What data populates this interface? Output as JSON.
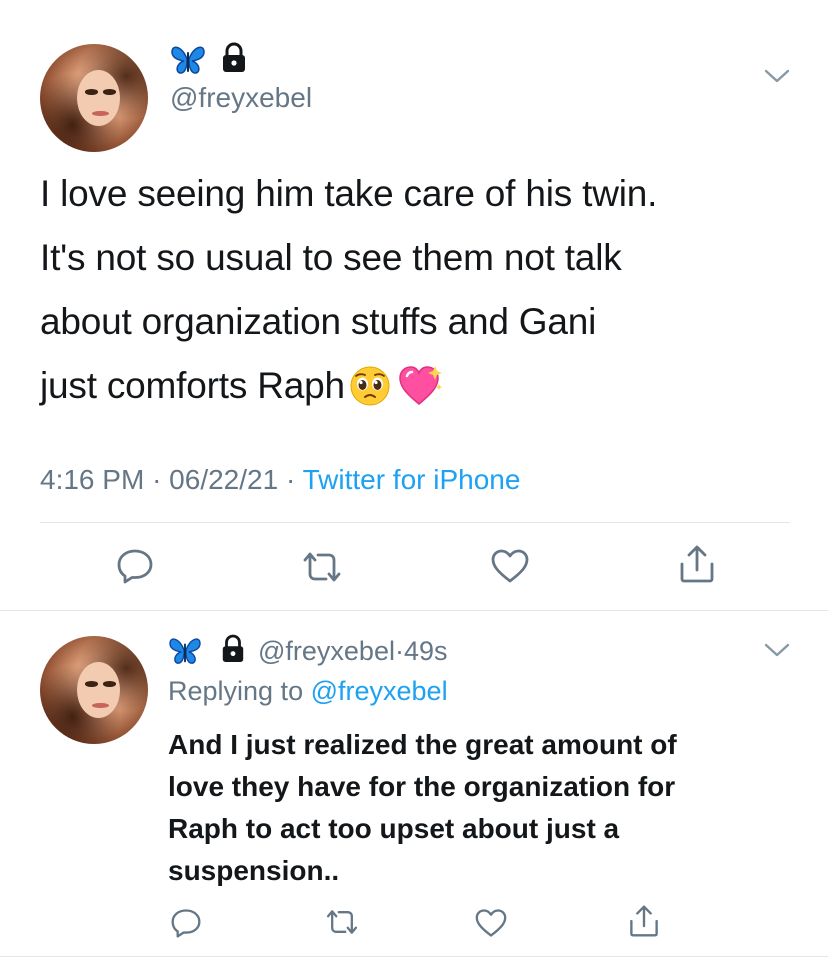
{
  "tweet": {
    "handle": "@freyxebel",
    "text_lines": [
      "I love seeing him take care of his twin.",
      "It's not so usual to see them not talk",
      "about organization stuffs and Gani",
      "just comforts Raph"
    ],
    "emoji": [
      "pleading-face-emoji",
      "sparkling-heart-emoji"
    ],
    "time": "4:16 PM",
    "separator": "·",
    "date": "06/22/21",
    "source": "Twitter for iPhone",
    "actions": [
      "reply-icon",
      "retweet-icon",
      "like-icon",
      "share-icon"
    ]
  },
  "reply": {
    "handle": "@freyxebel",
    "separator": "·",
    "age": "49s",
    "replying_prefix": "Replying to",
    "replying_handle": "@freyxebel",
    "text_lines": [
      "And I just realized the great amount of",
      "love they have for the organization for",
      "Raph to act too upset about just a",
      "suspension.."
    ]
  },
  "colors": {
    "accent": "#1da1f2",
    "secondary_text": "#657786",
    "butterfly": "#1e88e5"
  }
}
